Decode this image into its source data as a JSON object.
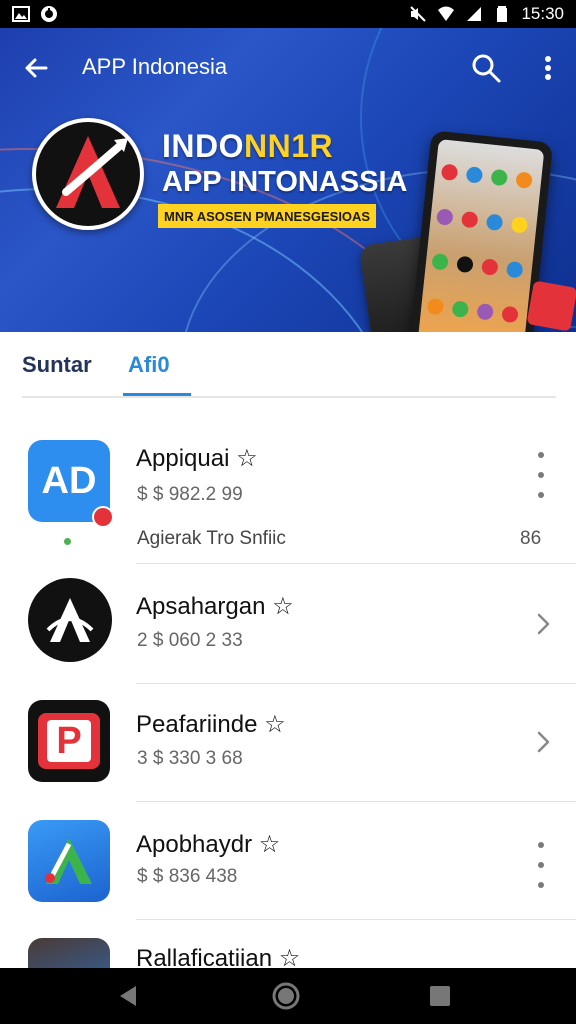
{
  "status_bar": {
    "time": "15:30",
    "icons": [
      "picture-icon",
      "notification-icon",
      "mute-icon",
      "wifi-icon",
      "signal-icon",
      "battery-icon"
    ]
  },
  "app_bar": {
    "title": "APP Indonesia",
    "back_icon": "arrow-left-icon",
    "search_icon": "search-icon",
    "more_icon": "more-vertical-icon"
  },
  "banner": {
    "title_line1_part1": "INDO",
    "title_line1_part2": "NN1R",
    "title_line2": "APP INTONASSIA",
    "tagline": "MNR ASOSEN PMANESGESIOAS",
    "colors": {
      "bg": "#1e3fae",
      "highlight": "#ffd21f",
      "badge": "#e4323a"
    }
  },
  "tabs": [
    {
      "label": "Suntar",
      "active": false
    },
    {
      "label": "Afi0",
      "active": true
    }
  ],
  "colors": {
    "accent": "#2a89d8",
    "tab_inactive": "#23345c"
  },
  "apps": [
    {
      "name": "Appiquai ☆",
      "price": "$ $ 982.2 99",
      "desc": "Agierak Tro Snfiic",
      "count": "86",
      "icon": "ad-logo-icon",
      "action": "more"
    },
    {
      "name": "Apsahargan ☆",
      "price": "2 $ 060 2 33",
      "icon": "a-circle-logo-icon",
      "action": "chevron"
    },
    {
      "name": "Peafariinde ☆",
      "price": "3 $ 330 3 68",
      "icon": "p-logo-icon",
      "action": "chevron"
    },
    {
      "name": "Apobhaydr ☆",
      "price": "$ $ 836 438",
      "icon": "a-blue-logo-icon",
      "action": "more"
    },
    {
      "name": "Rallaficatiian ☆",
      "icon": "photo-app-icon",
      "action": "more"
    }
  ],
  "nav_bar": {
    "icons": [
      "back-triangle-icon",
      "home-circle-icon",
      "recents-square-icon"
    ]
  }
}
